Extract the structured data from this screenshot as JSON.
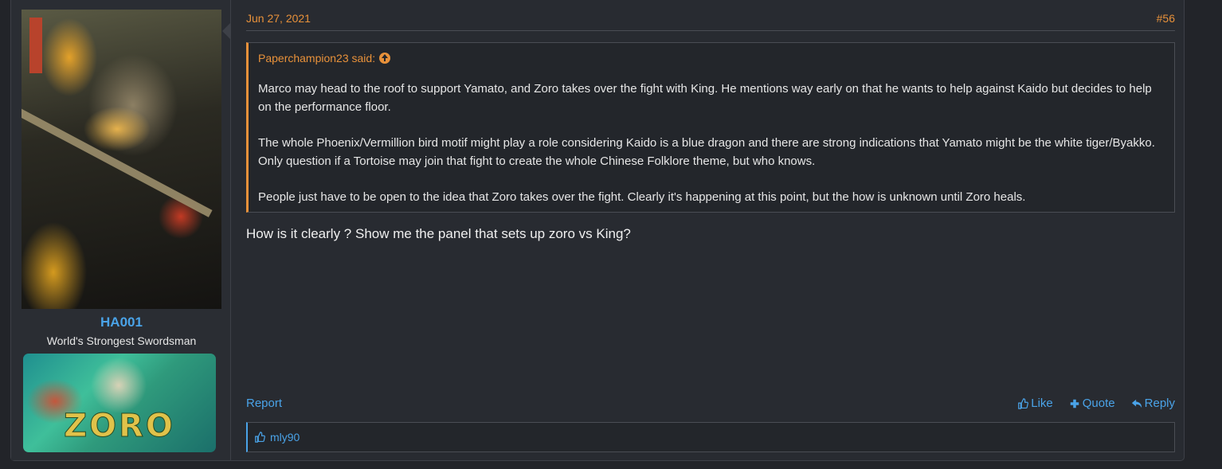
{
  "user": {
    "name": "HA001",
    "title": "World's Strongest Swordsman",
    "banner_text": "ZORO"
  },
  "post": {
    "date": "Jun 27, 2021",
    "number": "#56",
    "quote": {
      "author_said": "Paperchampion23 said:",
      "paragraphs": [
        "Marco may head to the roof to support Yamato, and Zoro takes over the fight with King. He mentions way early on that he wants to help against Kaido but decides to help on the performance floor.",
        "The whole Phoenix/Vermillion bird motif might play a role considering Kaido is a blue dragon and there are strong indications that Yamato might be the white tiger/Byakko. Only question if a Tortoise may join that fight to create the whole Chinese Folklore theme, but who knows.",
        "People just have to be open to the idea that Zoro takes over the fight. Clearly it's happening at this point, but the how is unknown until Zoro heals."
      ]
    },
    "body": "How is it clearly ? Show me the panel that sets up zoro vs King?",
    "actions": {
      "report": "Report",
      "like": "Like",
      "quote": "Quote",
      "reply": "Reply"
    },
    "likes": "mly90"
  },
  "colors": {
    "accent": "#e8913a",
    "link": "#4aa3e8",
    "background": "#282b31"
  }
}
